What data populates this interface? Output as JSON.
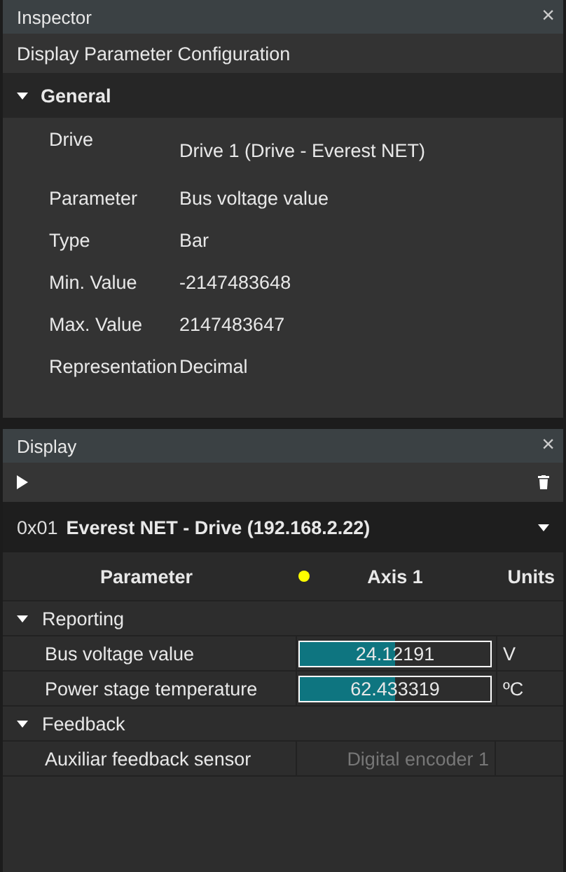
{
  "inspector": {
    "title": "Inspector",
    "close": "×",
    "subtitle": "Display Parameter Configuration",
    "section": {
      "label": "General",
      "expanded": true,
      "properties": [
        {
          "label": "Drive",
          "value": "Drive 1 (Drive - Everest NET)"
        },
        {
          "label": "Parameter",
          "value": "Bus voltage value"
        },
        {
          "label": "Type",
          "value": "Bar"
        },
        {
          "label": "Min. Value",
          "value": "-2147483648"
        },
        {
          "label": "Max. Value",
          "value": "2147483647"
        },
        {
          "label": "Representation",
          "value": "Decimal"
        }
      ]
    }
  },
  "display": {
    "title": "Display",
    "close": "×",
    "device": {
      "address": "0x01",
      "name": "Everest NET - Drive (192.168.2.22)"
    },
    "columns": [
      {
        "label": "Parameter"
      },
      {
        "label": "Axis 1",
        "color": "#ffff00"
      },
      {
        "label": "Units"
      }
    ],
    "groups": [
      {
        "label": "Reporting",
        "expanded": true,
        "rows": [
          {
            "name": "Bus voltage value",
            "kind": "bar",
            "value": "24.12191",
            "level": 0.5,
            "units": "V",
            "disabled": false
          },
          {
            "name": "Power stage temperature",
            "kind": "bar",
            "value": "62.433319",
            "level": 0.5,
            "units": "ºC",
            "disabled": false
          }
        ]
      },
      {
        "label": "Feedback",
        "expanded": true,
        "rows": [
          {
            "name": "Auxiliar feedback sensor",
            "kind": "text",
            "value": "Digital encoder 1",
            "disabled": true
          }
        ]
      }
    ]
  }
}
